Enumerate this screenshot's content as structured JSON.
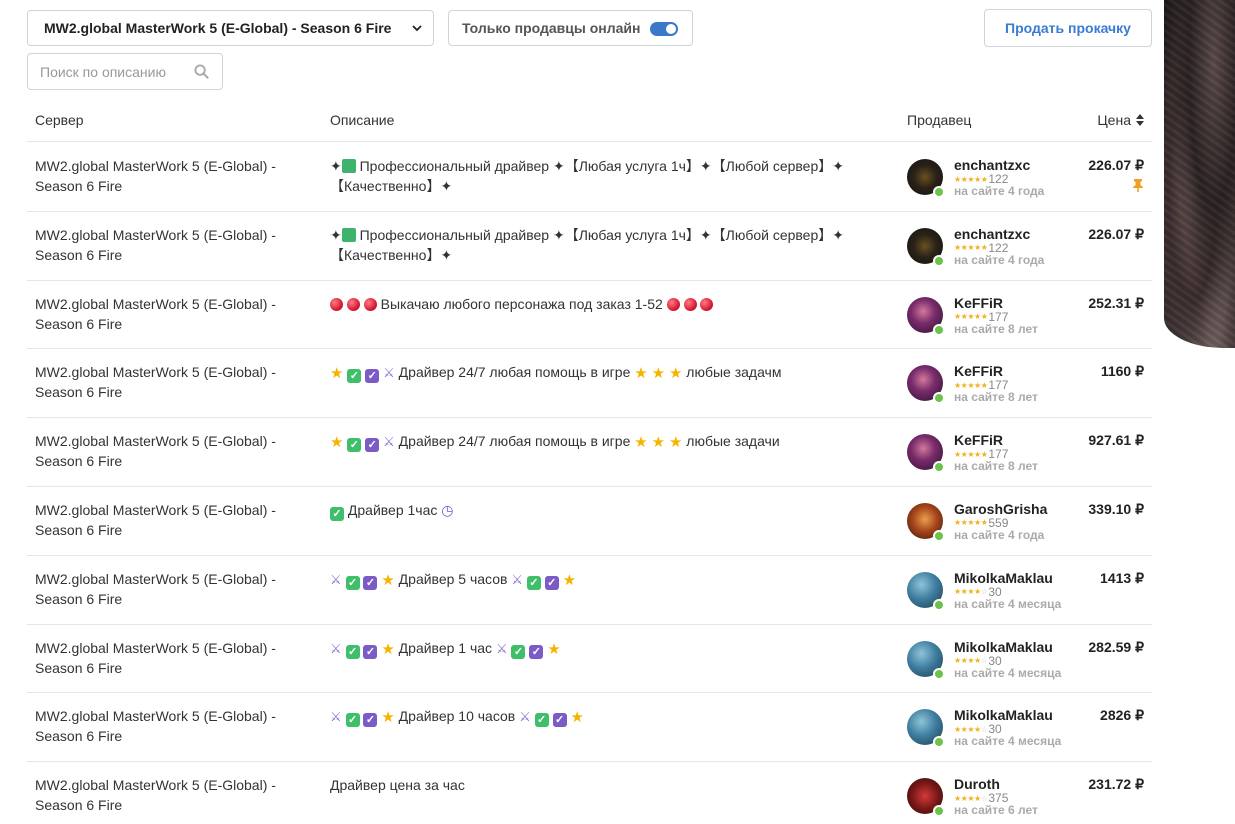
{
  "filters": {
    "server_select": "MW2.global MasterWork 5 (E-Global) - Season 6 Fire",
    "online_only_label": "Только продавцы онлайн",
    "online_only_on": true,
    "sell_button": "Продать прокачку",
    "search_placeholder": "Поиск по описанию"
  },
  "table": {
    "headers": {
      "server": "Сервер",
      "description": "Описание",
      "seller": "Продавец",
      "price": "Цена"
    },
    "rows": [
      {
        "server": "MW2.global MasterWork 5 (E-Global) - Season 6 Fire",
        "description": "✦🟩 Профессиональный драйвер ✦【Любая услуга 1ч】✦【Любой сервер】✦【Качественно】✦",
        "seller": "enchantzxc",
        "rating": 5,
        "reviews": "122",
        "since": "на сайте 4 года",
        "price": "226.07 ₽",
        "pinned": true,
        "avatar": "lineage"
      },
      {
        "server": "MW2.global MasterWork 5 (E-Global) - Season 6 Fire",
        "description": "✦🟩 Профессиональный драйвер ✦【Любая услуга 1ч】✦【Любой сервер】✦【Качественно】✦",
        "seller": "enchantzxc",
        "rating": 5,
        "reviews": "122",
        "since": "на сайте 4 года",
        "price": "226.07 ₽",
        "pinned": false,
        "avatar": "lineage"
      },
      {
        "server": "MW2.global MasterWork 5 (E-Global) - Season 6 Fire",
        "description": "🔴 🔴 🔴 Выкачаю любого персонажа под заказ 1-52 🔴 🔴 🔴",
        "seller": "KeFFiR",
        "rating": 5,
        "reviews": "177",
        "since": "на сайте 8 лет",
        "price": "252.31 ₽",
        "pinned": false,
        "avatar": "keffir"
      },
      {
        "server": "MW2.global MasterWork 5 (E-Global) - Season 6 Fire",
        "description": "⭐ ✅ ☑️ ⚔️ Драйвер 24/7 любая помощь в игре ⭐ ⭐ ⭐ любые задачм",
        "seller": "KeFFiR",
        "rating": 5,
        "reviews": "177",
        "since": "на сайте 8 лет",
        "price": "1160 ₽",
        "pinned": false,
        "avatar": "keffir"
      },
      {
        "server": "MW2.global MasterWork 5 (E-Global) - Season 6 Fire",
        "description": "⭐ ✅ ☑️ ⚔️ Драйвер 24/7 любая помощь в игре ⭐ ⭐ ⭐ любые задачи",
        "seller": "KeFFiR",
        "rating": 5,
        "reviews": "177",
        "since": "на сайте 8 лет",
        "price": "927.61 ₽",
        "pinned": false,
        "avatar": "keffir"
      },
      {
        "server": "MW2.global MasterWork 5 (E-Global) - Season 6 Fire",
        "description": "✅ Драйвер 1час 🕒",
        "seller": "GaroshGrisha",
        "rating": 5,
        "reviews": "559",
        "since": "на сайте 4 года",
        "price": "339.10 ₽",
        "pinned": false,
        "avatar": "garosh"
      },
      {
        "server": "MW2.global MasterWork 5 (E-Global) - Season 6 Fire",
        "description": "⚔️ ✅ ☑️ ⭐ Драйвер 5 часов ⚔️ ✅ ☑️ ⭐",
        "seller": "MikolkaMaklau",
        "rating": 4,
        "reviews": "30",
        "since": "на сайте 4 месяца",
        "price": "1413 ₽",
        "pinned": false,
        "avatar": "mikolka"
      },
      {
        "server": "MW2.global MasterWork 5 (E-Global) - Season 6 Fire",
        "description": "⚔️ ✅ ☑️ ⭐ Драйвер 1 час ⚔️ ✅ ☑️ ⭐",
        "seller": "MikolkaMaklau",
        "rating": 4,
        "reviews": "30",
        "since": "на сайте 4 месяца",
        "price": "282.59 ₽",
        "pinned": false,
        "avatar": "mikolka"
      },
      {
        "server": "MW2.global MasterWork 5 (E-Global) - Season 6 Fire",
        "description": "⚔️ ✅ ☑️ ⭐ Драйвер 10 часов ⚔️ ✅ ☑️ ⭐",
        "seller": "MikolkaMaklau",
        "rating": 4,
        "reviews": "30",
        "since": "на сайте 4 месяца",
        "price": "2826 ₽",
        "pinned": false,
        "avatar": "mikolka"
      },
      {
        "server": "MW2.global MasterWork 5 (E-Global) - Season 6 Fire",
        "description": "Драйвер цена за час",
        "seller": "Duroth",
        "rating": 4,
        "reviews": "375",
        "since": "на сайте 6 лет",
        "price": "231.72 ₽",
        "pinned": false,
        "avatar": "duroth"
      }
    ]
  },
  "colors": {
    "accent": "#3a7bd5",
    "toggle": "#3c78c8",
    "online_dot": "#6cc24a",
    "star": "#f2b01e",
    "pin": "#f0a020"
  }
}
